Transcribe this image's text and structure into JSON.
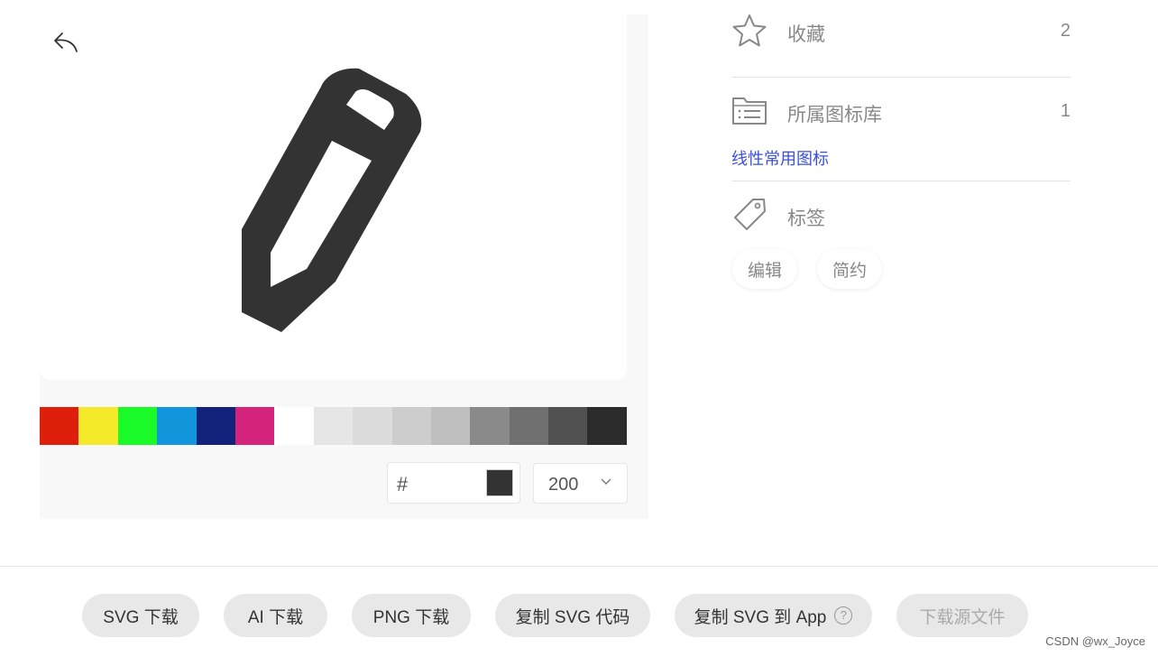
{
  "icons": {
    "back": "undo-arrow-icon",
    "preview": "pencil-icon",
    "favorite": "star-icon",
    "library": "folder-list-icon",
    "tag": "tag-icon",
    "dropdown": "chevron-down-icon",
    "help": "question-circle-icon"
  },
  "preview": {
    "icon_color": "#333333",
    "palette": [
      "#dd1f0b",
      "#f4ea2a",
      "#1afa29",
      "#1296db",
      "#13227a",
      "#d4237a",
      "#ffffff",
      "#e6e6e6",
      "#dbdbdb",
      "#cdcdcd",
      "#bfbfbf",
      "#8a8a8a",
      "#707070",
      "#515151",
      "#2c2c2c"
    ],
    "hex_prefix": "#",
    "hex_value": "",
    "size_value": "200"
  },
  "info": {
    "favorite_label": "收藏",
    "favorite_count": "2",
    "library_label": "所属图标库",
    "library_count": "1",
    "library_name": "线性常用图标",
    "tags_label": "标签",
    "tags": [
      "编辑",
      "简约"
    ]
  },
  "actions": {
    "svg_download": "SVG 下载",
    "ai_download": "AI 下载",
    "png_download": "PNG 下载",
    "copy_svg_code": "复制 SVG 代码",
    "copy_svg_app": "复制 SVG 到 App",
    "help_glyph": "?",
    "source_download": "下载源文件"
  },
  "watermark": "CSDN @wx_Joyce"
}
